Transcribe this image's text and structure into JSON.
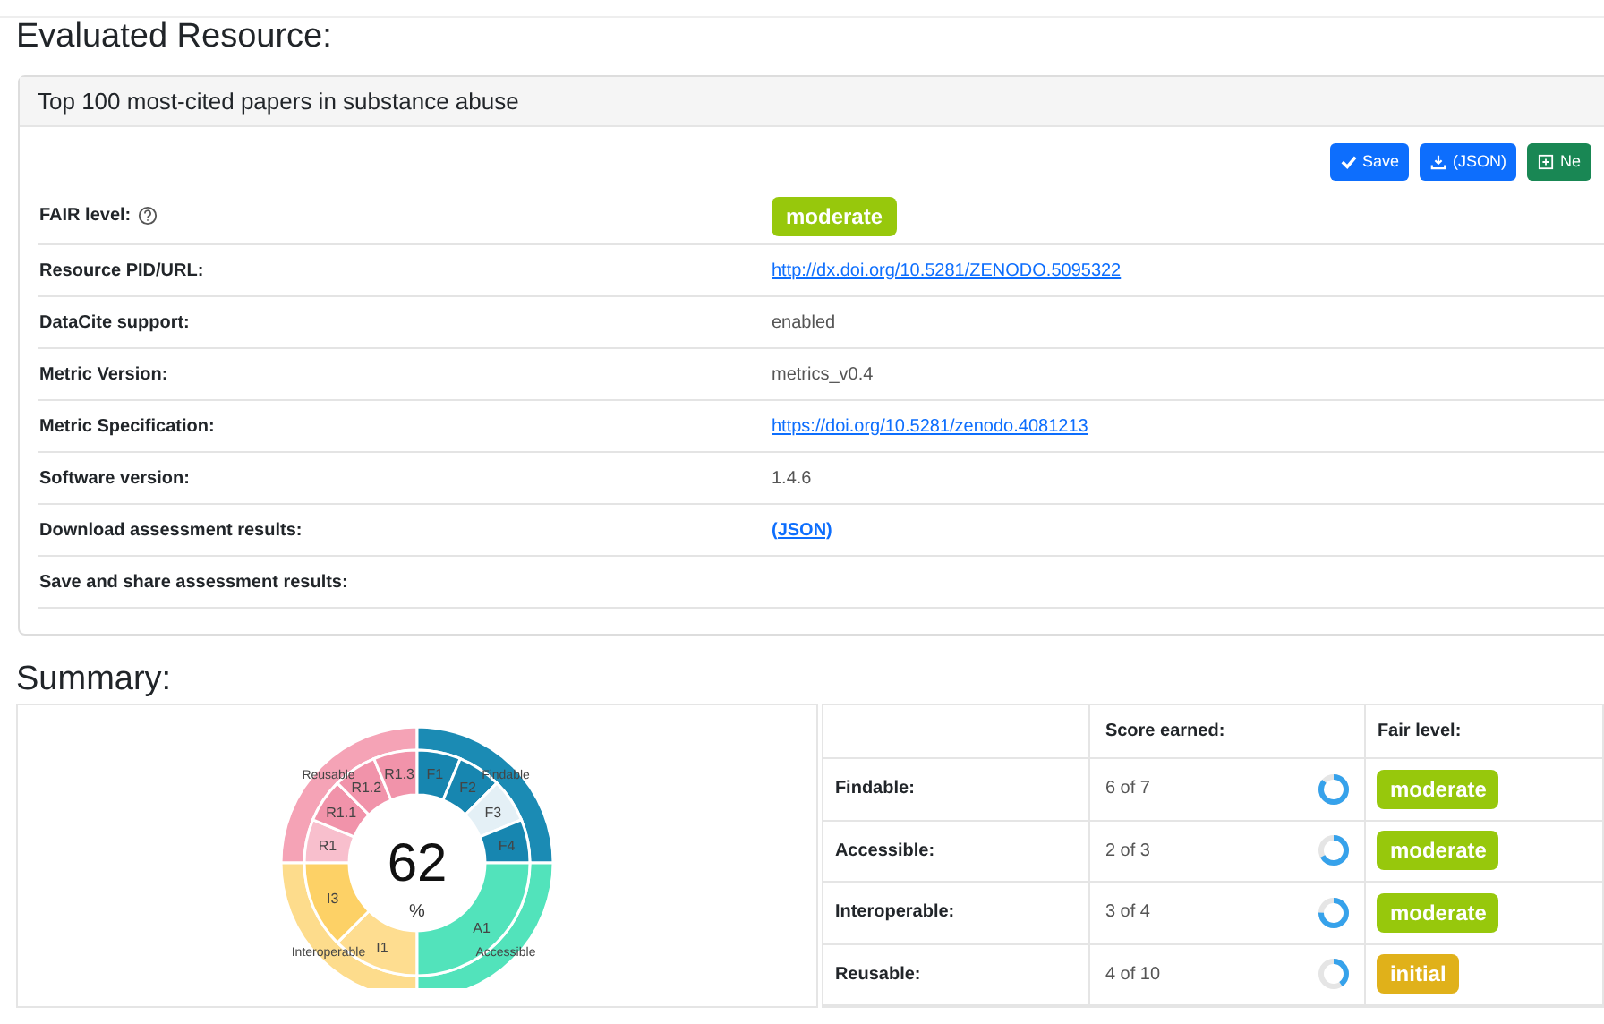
{
  "heading": "Evaluated Resource:",
  "resource": {
    "title": "Top 100 most-cited papers in substance abuse",
    "buttons": [
      {
        "label": "Save",
        "kind": "save"
      },
      {
        "label": "(JSON)",
        "kind": "download"
      },
      {
        "label": "Ne",
        "kind": "new"
      }
    ],
    "rows": [
      {
        "label": "FAIR level:",
        "kind": "badge",
        "value": "moderate",
        "color": "#97c80c",
        "help": true
      },
      {
        "label": "Resource PID/URL:",
        "kind": "link",
        "value": "http://dx.doi.org/10.5281/ZENODO.5095322"
      },
      {
        "label": "DataCite support:",
        "kind": "text",
        "value": "enabled"
      },
      {
        "label": "Metric Version:",
        "kind": "text",
        "value": "metrics_v0.4"
      },
      {
        "label": "Metric Specification:",
        "kind": "link",
        "value": "https://doi.org/10.5281/zenodo.4081213"
      },
      {
        "label": "Software version:",
        "kind": "text",
        "value": "1.4.6"
      },
      {
        "label": "Download assessment results:",
        "kind": "boldlink",
        "value": "(JSON)"
      },
      {
        "label": "Save and share assessment results:",
        "kind": "empty"
      }
    ]
  },
  "summary_heading": "Summary:",
  "sunburst": {
    "score": "62",
    "unit": "%",
    "groups": [
      {
        "name": "Reusable",
        "color": "#f5a3b6",
        "segments": [
          {
            "label": "R1",
            "color": "#f8bfcd"
          },
          {
            "label": "R1.1",
            "color": "#f193aa"
          },
          {
            "label": "R1.2",
            "color": "#f193aa"
          },
          {
            "label": "R1.3",
            "color": "#f193aa"
          }
        ]
      },
      {
        "name": "Findable",
        "color": "#1b8bb4",
        "segments": [
          {
            "label": "F1",
            "color": "#1786b0"
          },
          {
            "label": "F2",
            "color": "#1786b0"
          },
          {
            "label": "F3",
            "color": "#e4f0f6"
          },
          {
            "label": "F4",
            "color": "#1786b0"
          }
        ]
      },
      {
        "name": "Interoperable",
        "color": "#fddc8c",
        "segments": [
          {
            "label": "I1",
            "color": "#fedd90"
          },
          {
            "label": "I3",
            "color": "#fdd166"
          }
        ]
      },
      {
        "name": "Accessible",
        "color": "#52e3bb",
        "segments": [
          {
            "label": "A1",
            "color": "#52e3bb"
          }
        ]
      }
    ]
  },
  "score_table": {
    "columns": [
      "Score earned:",
      "Fair level:"
    ],
    "rows": [
      {
        "name": "Findable:",
        "score": "6 of 7",
        "level": 0.857,
        "badge": "moderate",
        "color": "#97c80c"
      },
      {
        "name": "Accessible:",
        "score": "2 of 3",
        "level": 0.667,
        "badge": "moderate",
        "color": "#97c80c"
      },
      {
        "name": "Interoperable:",
        "score": "3 of 4",
        "level": 0.75,
        "badge": "moderate",
        "color": "#97c80c"
      },
      {
        "name": "Reusable:",
        "score": "4 of 10",
        "level": 0.4,
        "badge": "initial",
        "color": "#e0b11a"
      }
    ]
  }
}
